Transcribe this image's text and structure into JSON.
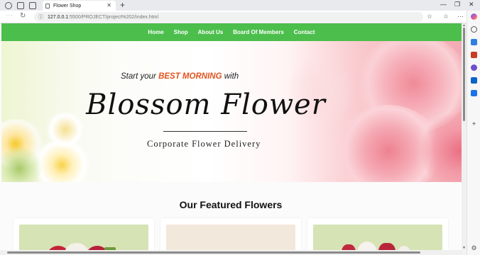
{
  "browser": {
    "tab_title": "Flower Shop",
    "tab_close": "✕",
    "new_tab": "+",
    "url_host": "127.0.0.1",
    "url_path": ":5500/PROJECT/project%202/index.html",
    "minimize": "—",
    "maximize": "❐",
    "close": "✕"
  },
  "site": {
    "nav": [
      "Home",
      "Shop",
      "About Us",
      "Board Of Members",
      "Contact"
    ],
    "hero": {
      "tagline_prefix": "Start your",
      "tagline_highlight": "BEST MORNING",
      "tagline_suffix": "with",
      "brand": "Blossom Flower",
      "subtitle": "Corporate Flower Delivery"
    },
    "featured_title": "Our Featured Flowers"
  },
  "colors": {
    "nav_green": "#4cbe4c",
    "accent_orange": "#e2531d",
    "card_bg_green": "#d6e3b4",
    "card_bg_cream": "#f3e8dc"
  },
  "icons": [
    "profile-icon",
    "collections-icon",
    "workspaces-icon",
    "back-icon",
    "refresh-icon",
    "info-icon",
    "favorite-star-icon",
    "favorites-icon",
    "more-icon",
    "copilot-icon",
    "search-icon",
    "shopping-icon",
    "games-icon",
    "outlook-icon",
    "office-icon",
    "add-icon",
    "settings-icon"
  ]
}
